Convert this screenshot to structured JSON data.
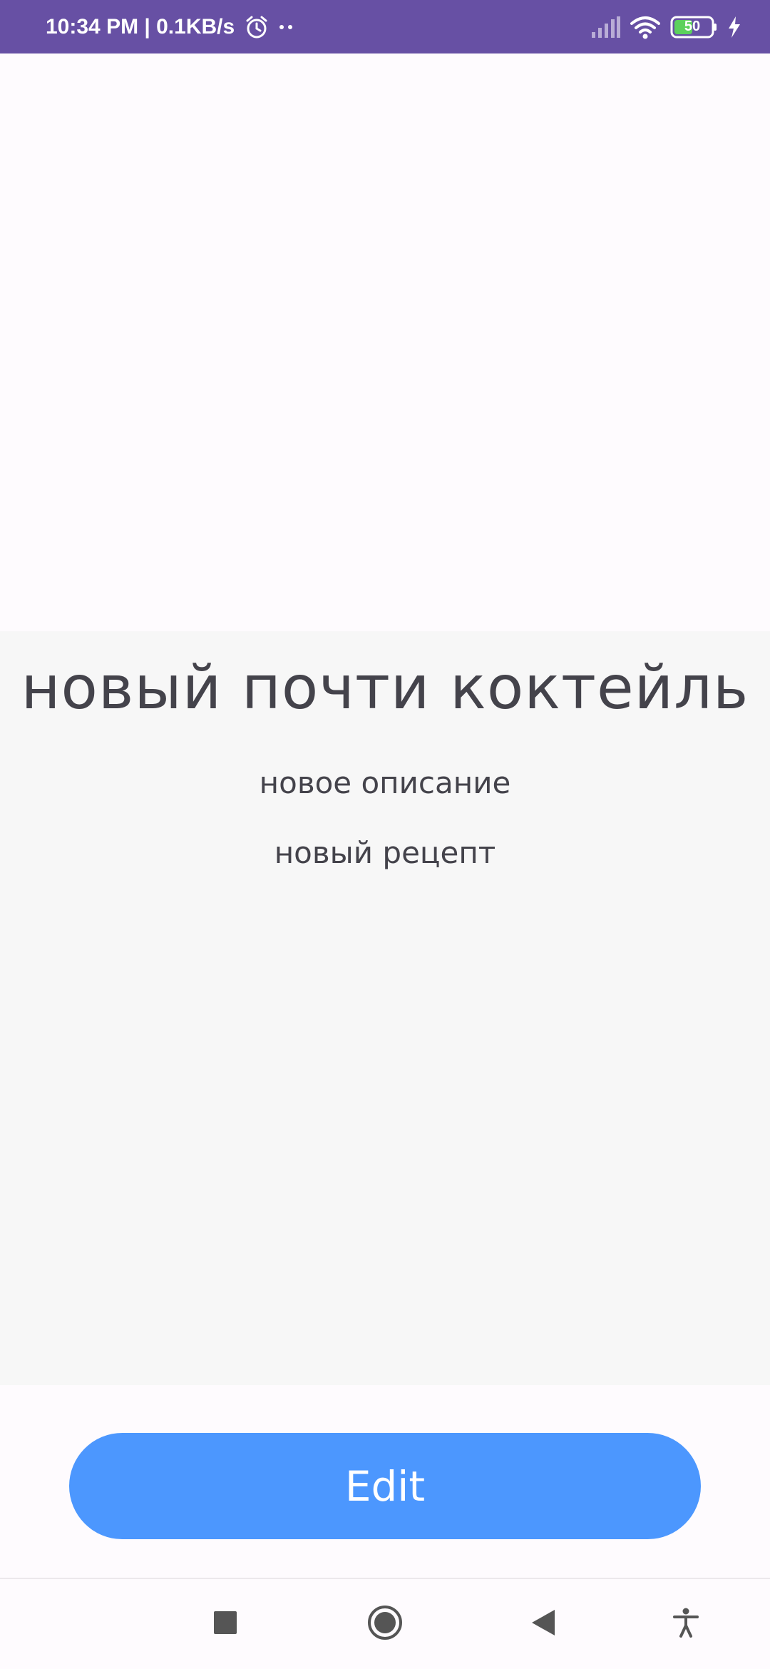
{
  "status_bar": {
    "time_speed": "10:34 PM | 0.1KB/s",
    "battery_level": "50",
    "bar_color": "#6750A4",
    "icons": [
      "alarm-icon",
      "dots-icon",
      "signal-icon",
      "wifi-icon",
      "battery-icon",
      "charging-icon"
    ]
  },
  "cocktail": {
    "title": "новый почти коктейль",
    "description": "новое описание",
    "recipe": "новый рецепт"
  },
  "actions": {
    "edit_label": "Edit",
    "edit_color": "#4C97FE"
  },
  "nav_bar": {
    "icons": [
      "recents-icon",
      "home-icon",
      "back-icon",
      "accessibility-icon"
    ]
  }
}
